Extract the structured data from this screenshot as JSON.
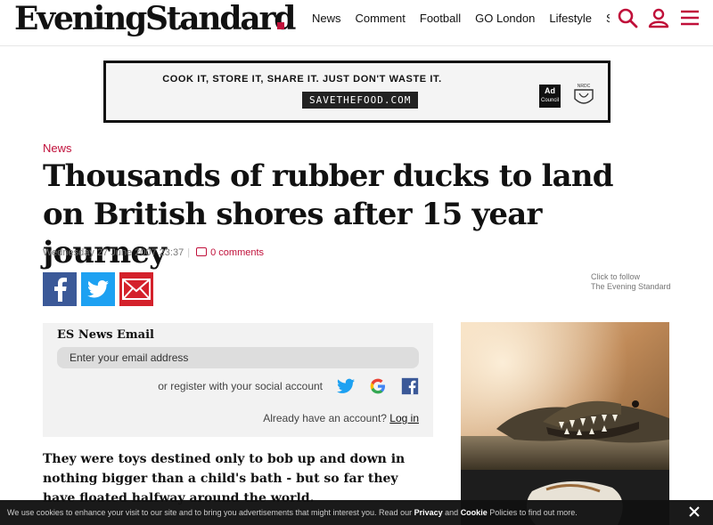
{
  "header": {
    "logo": "EveningStandard",
    "nav": [
      "News",
      "Comment",
      "Football",
      "GO London",
      "Lifestyle",
      "Sh"
    ],
    "brand_color": "#c0103a"
  },
  "ad": {
    "headline": "COOK IT, STORE IT, SHARE IT. JUST DON'T WASTE IT.",
    "button": "SAVETHEFOOD.COM",
    "adcouncil_top": "Ad",
    "adcouncil_bottom": "Council",
    "nrdc": "NRDC"
  },
  "article": {
    "section": "News",
    "headline": "Thousands of rubber ducks to land on British shores after 15 year journey",
    "date": "Wednesday 27 June 2007 23:37",
    "comments": "0 comments",
    "follow_line1": "Click to follow",
    "follow_line2": "The Evening Standard",
    "lede": "They were toys destined only to bob up and down in nothing bigger than a child's bath - but so far they have floated halfway around the world."
  },
  "newsletter": {
    "title": "ES News Email",
    "placeholder": "Enter your email address",
    "social_text": "or register with your social account",
    "login_prompt": "Already have an account?",
    "login_link": "Log in"
  },
  "cookie": {
    "text_before": "We use cookies to enhance your visit to our site and to bring you advertisements that might interest you. Read our",
    "privacy": "Privacy",
    "and": "and",
    "cookie_word": "Cookie",
    "text_after": "Policies to find out more."
  }
}
